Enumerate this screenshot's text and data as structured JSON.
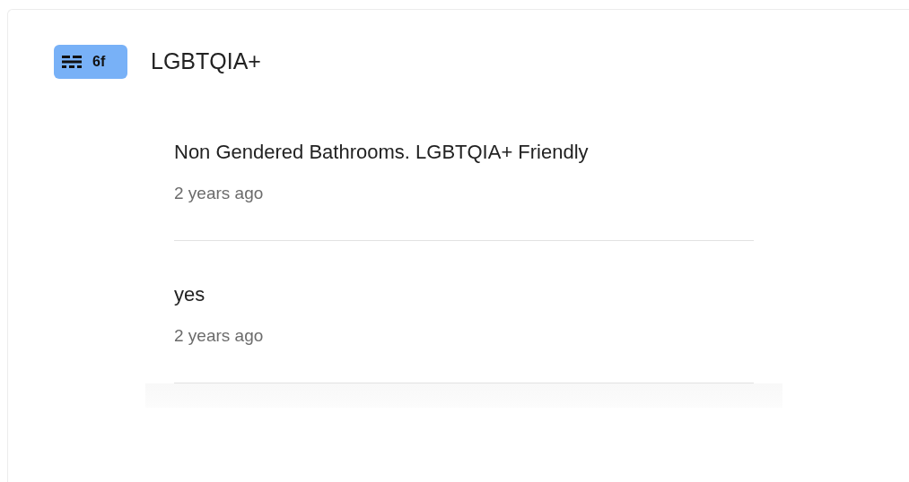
{
  "tag": {
    "label": "6f"
  },
  "title": "LGBTQIA+",
  "comments": [
    {
      "text": "Non Gendered Bathrooms. LGBTQIA+ Friendly",
      "time": "2 years ago"
    },
    {
      "text": "yes",
      "time": "2 years ago"
    }
  ]
}
